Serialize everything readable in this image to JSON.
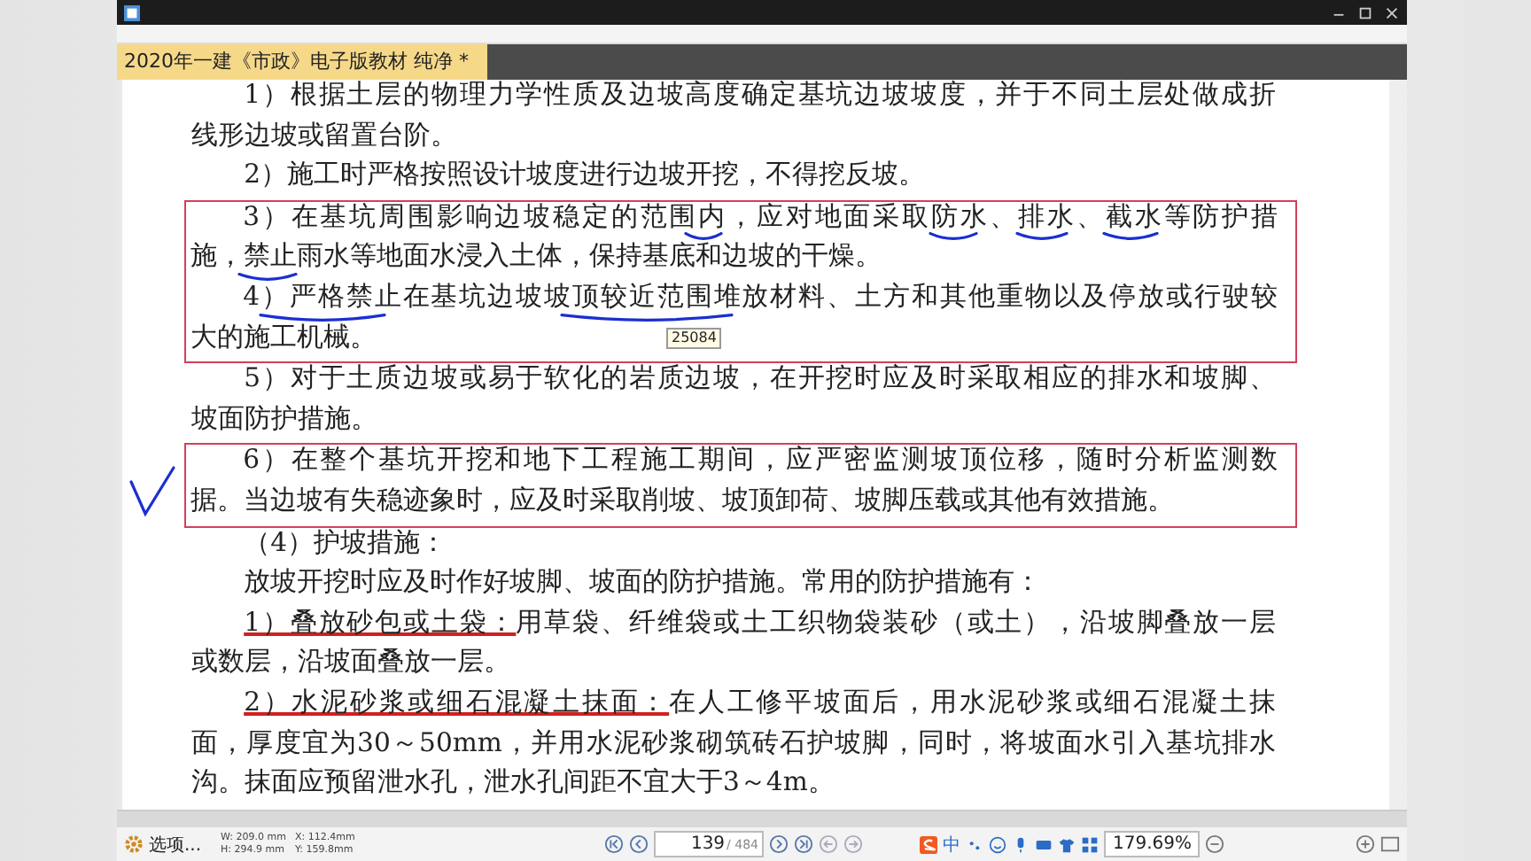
{
  "tab": {
    "label": "2020年一建《市政》电子版教材 纯净 *",
    "selected": true
  },
  "document": {
    "sections": [
      {
        "paragraphs": [
          {
            "lines": [
              "1）根据土层的物理力学性质及边坡高度确定基坑边坡坡度，并于不同土层处做成折",
              "线形边坡或留置台阶。"
            ]
          },
          {
            "lines": [
              "2）施工时严格按照设计坡度进行边坡开挖，不得挖反坡。"
            ]
          }
        ]
      },
      {
        "framed": true,
        "paragraphs": [
          {
            "lines": [
              "3）在基坑周围影响边坡稳定的范围内，应对地面采取防水、排水、截水等防护措",
              "施，禁止雨水等地面水浸入土体，保持基底和边坡的干燥。"
            ]
          },
          {
            "lines": [
              "4）严格禁止在基坑边坡坡顶较近范围堆放材料、土方和其他重物以及停放或行驶较",
              "大的施工机械。"
            ]
          }
        ]
      },
      {
        "paragraphs": [
          {
            "lines": [
              "5）对于土质边坡或易于软化的岩质边坡，在开挖时应及时采取相应的排水和坡脚、",
              "坡面防护措施。"
            ]
          }
        ]
      },
      {
        "framed": true,
        "paragraphs": [
          {
            "lines": [
              "6）在整个基坑开挖和地下工程施工期间，应严密监测坡顶位移，随时分析监测数",
              "据。当边坡有失稳迹象时，应及时采取削坡、坡顶卸荷、坡脚压载或其他有效措施。"
            ]
          }
        ]
      },
      {
        "paragraphs": [
          {
            "lines": [
              "（4）护坡措施："
            ]
          },
          {
            "lines": [
              "放坡开挖时应及时作好坡脚、坡面的防护措施。常用的防护措施有："
            ]
          },
          {
            "lead": "1）叠放砂包或土袋：",
            "lines": [
              "用草袋、纤维袋或土工织物袋装砂（或土），沿坡脚叠放一层",
              "或数层，沿坡面叠放一层。"
            ]
          },
          {
            "lead": "2）水泥砂浆或细石混凝土抹面：",
            "lines": [
              "在人工修平坡面后，用水泥砂浆或细石混凝土抹",
              "面，厚度宜为30～50mm，并用水泥砂浆砌筑砖石护坡脚，同时，将坡面水引入基坑排水",
              "沟。抹面应预留泄水孔，泄水孔间距不宜大于3～4m。"
            ]
          }
        ]
      }
    ]
  },
  "tooltip": "25084",
  "status_bar": {
    "options": "选项...",
    "dims": [
      "W: 209.0 mm",
      "X: 112.4mm",
      "H: 294.9 mm",
      "Y: 159.8mm"
    ],
    "page": "139",
    "page_total": "/ 484",
    "ime": "中",
    "zoom": "179.69%"
  }
}
